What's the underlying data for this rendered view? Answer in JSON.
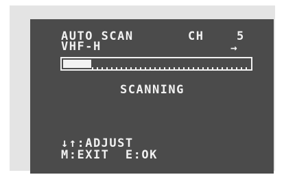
{
  "osd": {
    "title": "AUTO SCAN",
    "channel_label": "CH",
    "channel_value": "5",
    "band": "VHF-H",
    "direction_arrow": "→",
    "scan_progress_percent": 15,
    "status": "SCANNING",
    "help_adjust": "↓↑:ADJUST",
    "help_exit_ok": "M:EXIT  E:OK"
  },
  "colors": {
    "screen_background": "#4b4b4b",
    "osd_text": "#f2f2f2",
    "frame": "#e4e4e4"
  }
}
